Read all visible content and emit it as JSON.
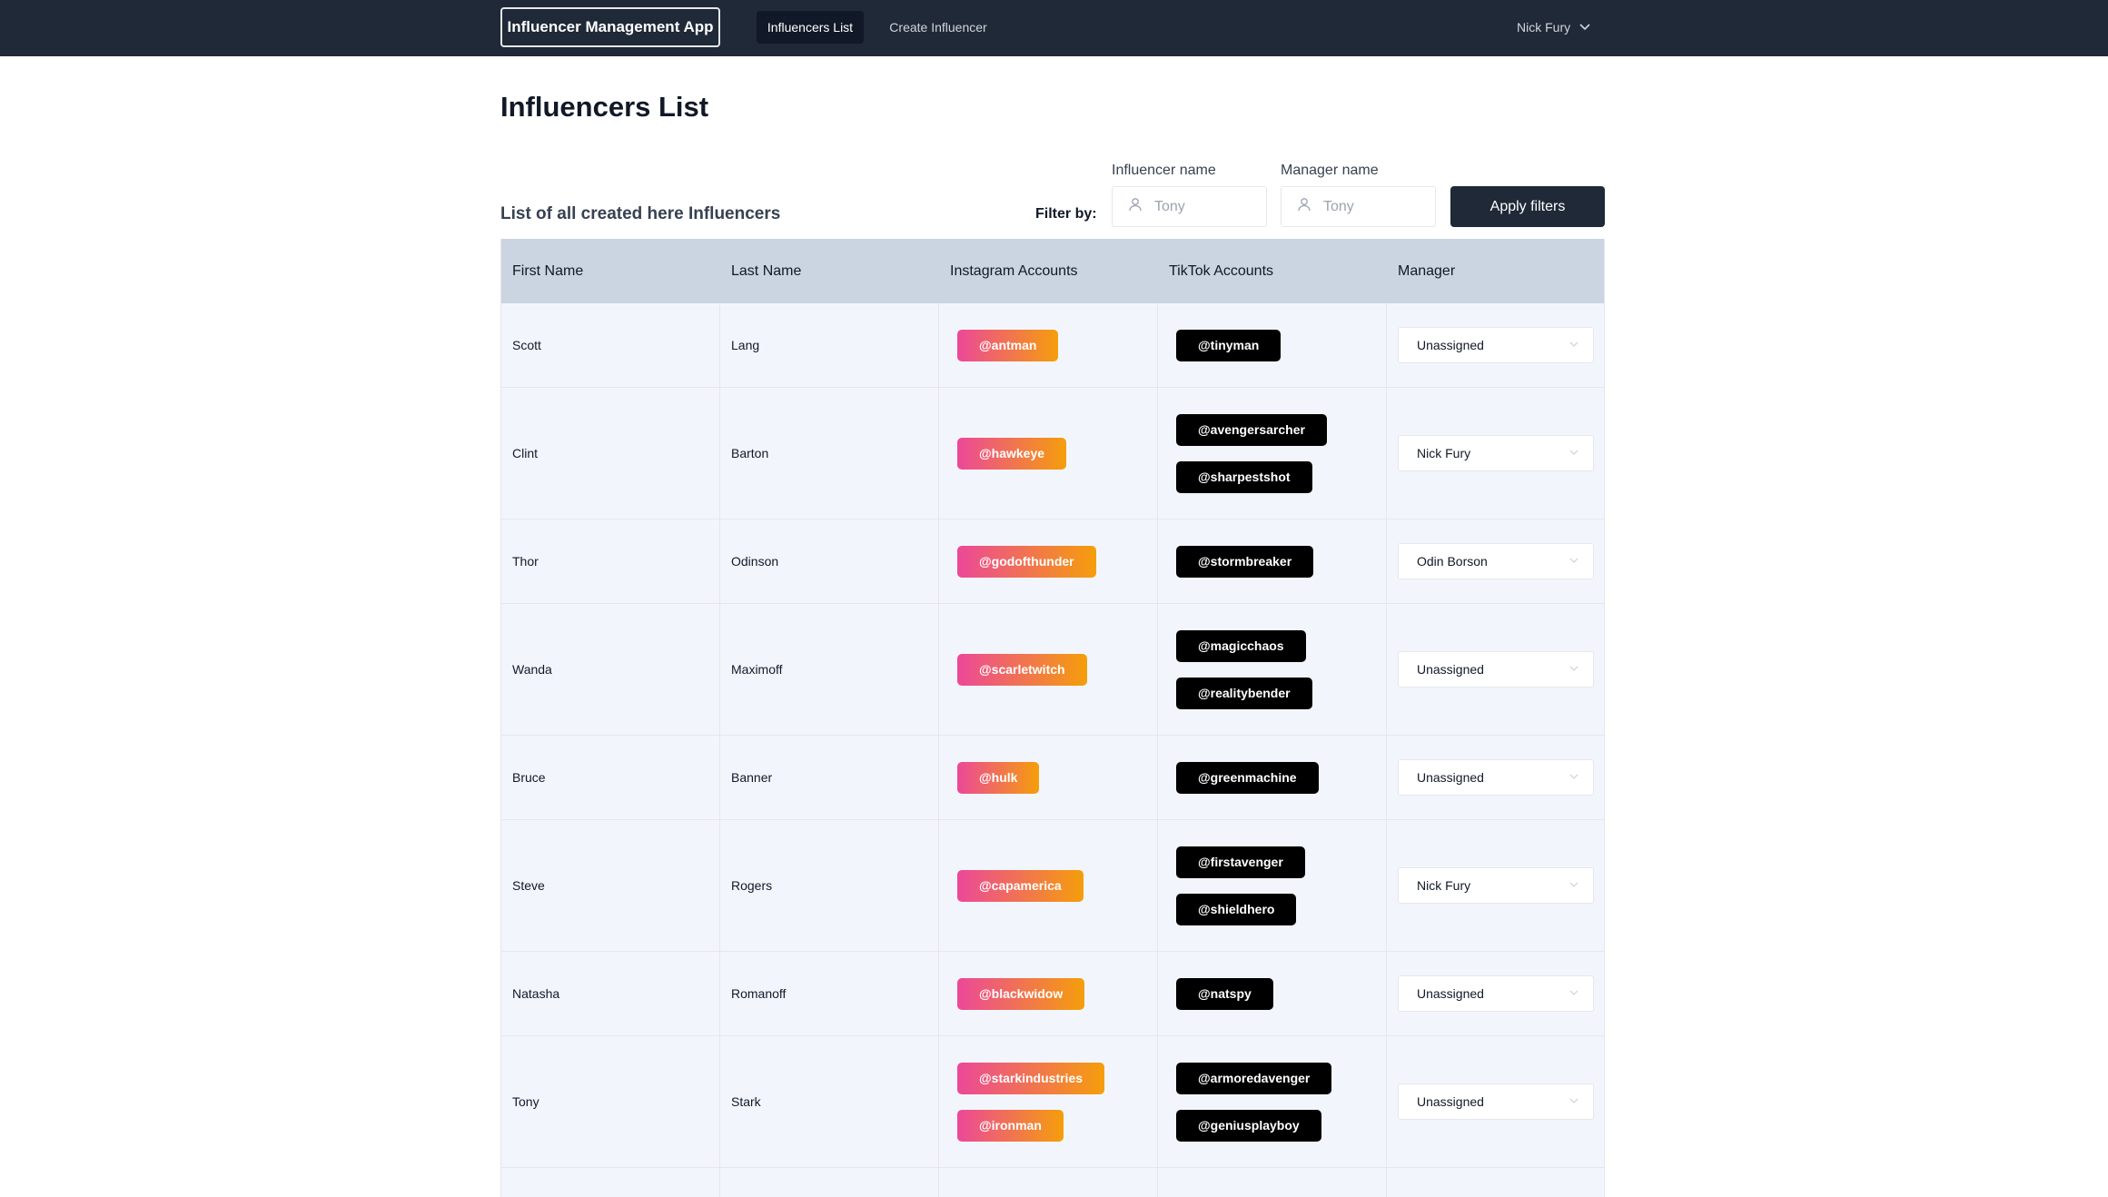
{
  "nav": {
    "brand": "Influencer Management App",
    "links": [
      {
        "label": "Influencers List",
        "active": true
      },
      {
        "label": "Create Influencer",
        "active": false
      }
    ],
    "user": {
      "name": "Nick Fury",
      "icon": "chevron-down-icon"
    }
  },
  "page": {
    "title": "Influencers List",
    "subtitle": "List of all created here Influencers"
  },
  "filters": {
    "label": "Filter by:",
    "influencer": {
      "label": "Influencer name",
      "placeholder": "Tony",
      "icon": "user-icon"
    },
    "manager": {
      "label": "Manager name",
      "placeholder": "Tony",
      "icon": "user-icon"
    },
    "apply_label": "Apply filters"
  },
  "table": {
    "headers": [
      "First Name",
      "Last Name",
      "Instagram Accounts",
      "TikTok Accounts",
      "Manager"
    ],
    "rows": [
      {
        "first": "Scott",
        "last": "Lang",
        "instagram": [
          "@antman"
        ],
        "tiktok": [
          "@tinyman"
        ],
        "manager": "Unassigned"
      },
      {
        "first": "Clint",
        "last": "Barton",
        "instagram": [
          "@hawkeye"
        ],
        "tiktok": [
          "@avengersarcher",
          "@sharpestshot"
        ],
        "manager": "Nick Fury"
      },
      {
        "first": "Thor",
        "last": "Odinson",
        "instagram": [
          "@godofthunder"
        ],
        "tiktok": [
          "@stormbreaker"
        ],
        "manager": "Odin Borson"
      },
      {
        "first": "Wanda",
        "last": "Maximoff",
        "instagram": [
          "@scarletwitch"
        ],
        "tiktok": [
          "@magicchaos",
          "@realitybender"
        ],
        "manager": "Unassigned"
      },
      {
        "first": "Bruce",
        "last": "Banner",
        "instagram": [
          "@hulk"
        ],
        "tiktok": [
          "@greenmachine"
        ],
        "manager": "Unassigned"
      },
      {
        "first": "Steve",
        "last": "Rogers",
        "instagram": [
          "@capamerica"
        ],
        "tiktok": [
          "@firstavenger",
          "@shieldhero"
        ],
        "manager": "Nick Fury"
      },
      {
        "first": "Natasha",
        "last": "Romanoff",
        "instagram": [
          "@blackwidow"
        ],
        "tiktok": [
          "@natspy"
        ],
        "manager": "Unassigned"
      },
      {
        "first": "Tony",
        "last": "Stark",
        "instagram": [
          "@starkindustries",
          "@ironman"
        ],
        "tiktok": [
          "@armoredavenger",
          "@geniusplayboy"
        ],
        "manager": "Unassigned"
      }
    ]
  },
  "colors": {
    "navbar": "#1f2937",
    "header_row": "#cbd5e1",
    "row_bg": "#f2f6fc",
    "instagram_gradient_start": "#ec4899",
    "instagram_gradient_end": "#f59e0b",
    "tiktok": "#000000"
  }
}
